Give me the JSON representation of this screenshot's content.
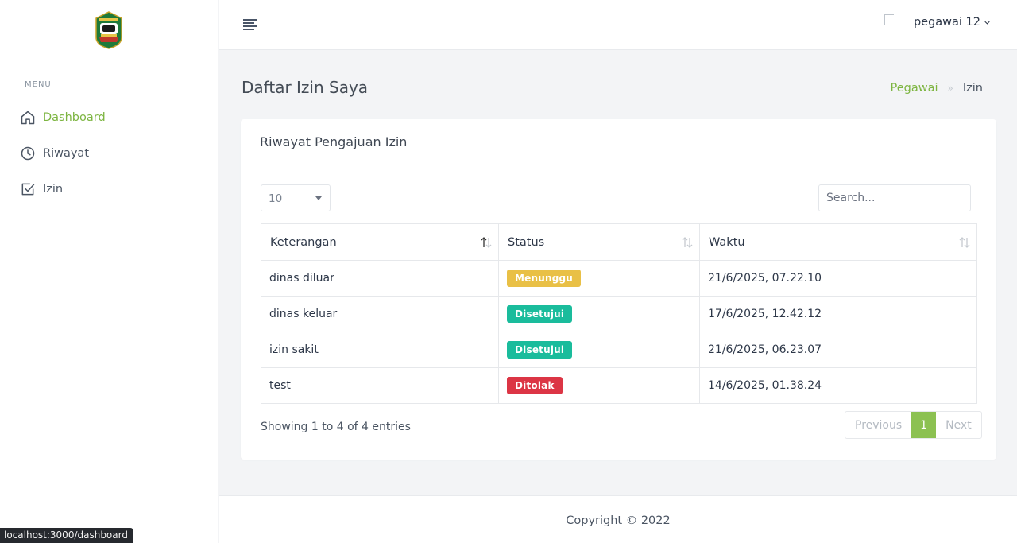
{
  "sidebar": {
    "menu_title": "MENU",
    "items": [
      {
        "label": "Dashboard",
        "icon": "home-icon",
        "active": true
      },
      {
        "label": "Riwayat",
        "icon": "clock-icon",
        "active": false
      },
      {
        "label": "Izin",
        "icon": "checkbox-icon",
        "active": false
      }
    ]
  },
  "topbar": {
    "user_name": "pegawai 12"
  },
  "page": {
    "title": "Daftar Izin Saya",
    "breadcrumb": {
      "link": "Pegawai",
      "separator": "»",
      "current": "Izin"
    }
  },
  "card": {
    "title": "Riwayat Pengajuan Izin",
    "length_value": "10",
    "search_placeholder": "Search...",
    "columns": [
      "Keterangan",
      "Status",
      "Waktu"
    ],
    "rows": [
      {
        "keterangan": "dinas diluar",
        "status": "Menunggu",
        "status_color": "#e9c046",
        "waktu": "21/6/2025, 07.22.10"
      },
      {
        "keterangan": "dinas keluar",
        "status": "Disetujui",
        "status_color": "#1abc9c",
        "waktu": "17/6/2025, 12.42.12"
      },
      {
        "keterangan": "izin sakit",
        "status": "Disetujui",
        "status_color": "#1abc9c",
        "waktu": "21/6/2025, 06.23.07"
      },
      {
        "keterangan": "test",
        "status": "Ditolak",
        "status_color": "#dc3545",
        "waktu": "14/6/2025, 01.38.24"
      }
    ],
    "info": "Showing 1 to 4 of 4 entries",
    "pagination": {
      "previous": "Previous",
      "current": "1",
      "next": "Next"
    }
  },
  "footer": {
    "text": "Copyright © 2022"
  },
  "statusbar": {
    "url": "localhost:3000/dashboard"
  },
  "colors": {
    "accent": "#7db541",
    "pagination_active": "#8cc152"
  }
}
